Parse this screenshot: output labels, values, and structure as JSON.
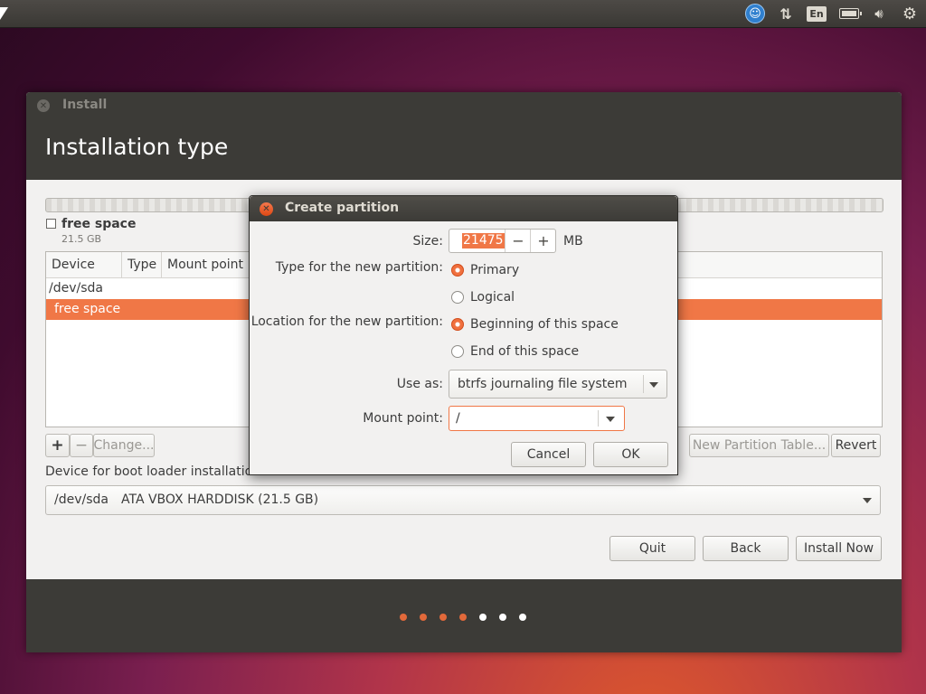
{
  "top_panel": {
    "icons": [
      "accessibility-icon",
      "network-icon",
      "keyboard-layout-indicator",
      "battery-icon",
      "volume-icon",
      "settings-gear-icon"
    ],
    "keyboard_layout": "En"
  },
  "window": {
    "title": "Install",
    "page_title": "Installation type"
  },
  "partition_bar": {
    "legend_label": "free space",
    "legend_size": "21.5 GB"
  },
  "partition_table": {
    "columns": [
      "Device",
      "Type",
      "Mount point"
    ],
    "rows": [
      {
        "device": "/dev/sda",
        "selected": false
      },
      {
        "device": "free space",
        "selected": true
      }
    ]
  },
  "table_toolbar": {
    "add": "+",
    "remove": "−",
    "change": "Change...",
    "new_table": "New Partition Table...",
    "revert": "Revert"
  },
  "boot_loader": {
    "label": "Device for boot loader installation:",
    "device": "/dev/sda",
    "description": "ATA VBOX HARDDISK (21.5 GB)"
  },
  "nav_buttons": {
    "quit": "Quit",
    "back": "Back",
    "install_now": "Install Now"
  },
  "progress": {
    "total_steps": 7,
    "completed_steps": 4,
    "active_color": "#e2693a",
    "inactive_color": "#ffffff"
  },
  "dialog": {
    "title": "Create partition",
    "size_label": "Size:",
    "size_value": "21475",
    "size_unit": "MB",
    "decrement": "−",
    "increment": "+",
    "type_label": "Type for the new partition:",
    "type_options": [
      {
        "label": "Primary",
        "selected": true
      },
      {
        "label": "Logical",
        "selected": false
      }
    ],
    "location_label": "Location for the new partition:",
    "location_options": [
      {
        "label": "Beginning of this space",
        "selected": true
      },
      {
        "label": "End of this space",
        "selected": false
      }
    ],
    "use_as_label": "Use as:",
    "use_as_value": "btrfs journaling file system",
    "mount_label": "Mount point:",
    "mount_value": "/",
    "cancel": "Cancel",
    "ok": "OK"
  },
  "colors": {
    "accent": "#f07746",
    "header_bg": "#3c3b37",
    "window_bg": "#f2f1f0"
  }
}
